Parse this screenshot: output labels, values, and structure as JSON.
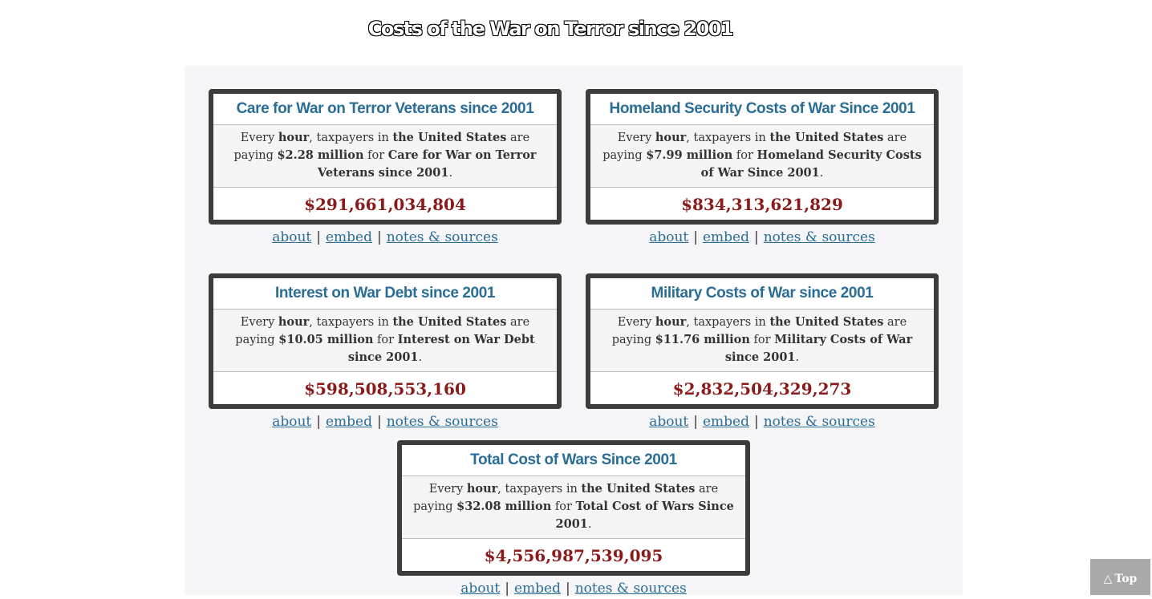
{
  "page": {
    "title": "Costs of the War on Terror since 2001"
  },
  "counters": [
    {
      "title": "Care for War on Terror Veterans since 2001",
      "desc_prefix": "Every ",
      "desc_hour": "hour",
      "desc_mid": ", taxpayers in ",
      "desc_country": "the United States",
      "desc_paying": " are paying ",
      "rate": "$2.28 million",
      "desc_for": " for ",
      "item": "Care for War on Terror Veterans since 2001",
      "desc_end": ".",
      "total": "$291,661,034,804"
    },
    {
      "title": "Homeland Security Costs of War Since 2001",
      "desc_prefix": "Every ",
      "desc_hour": "hour",
      "desc_mid": ", taxpayers in ",
      "desc_country": "the United States",
      "desc_paying": " are paying ",
      "rate": "$7.99 million",
      "desc_for": " for ",
      "item": "Homeland Security Costs of War Since 2001",
      "desc_end": ".",
      "total": "$834,313,621,829"
    },
    {
      "title": "Interest on War Debt since 2001",
      "desc_prefix": "Every ",
      "desc_hour": "hour",
      "desc_mid": ", taxpayers in ",
      "desc_country": "the United States",
      "desc_paying": " are paying ",
      "rate": "$10.05 million",
      "desc_for": " for ",
      "item": "Interest on War Debt since 2001",
      "desc_end": ".",
      "total": "$598,508,553,160"
    },
    {
      "title": "Military Costs of War since 2001",
      "desc_prefix": "Every ",
      "desc_hour": "hour",
      "desc_mid": ", taxpayers in ",
      "desc_country": "the United States",
      "desc_paying": " are paying ",
      "rate": "$11.76 million",
      "desc_for": " for ",
      "item": "Military Costs of War since 2001",
      "desc_end": ".",
      "total": "$2,832,504,329,273"
    },
    {
      "title": "Total Cost of Wars Since 2001",
      "desc_prefix": "Every ",
      "desc_hour": "hour",
      "desc_mid": ", taxpayers in ",
      "desc_country": "the United States",
      "desc_paying": " are paying ",
      "rate": "$32.08 million",
      "desc_for": " for ",
      "item": "Total Cost of Wars Since 2001",
      "desc_end": ".",
      "total": "$4,556,987,539,095"
    }
  ],
  "links": {
    "about": "about",
    "embed": "embed",
    "notes": "notes & sources",
    "separator": "|"
  },
  "top_button": {
    "icon": "triangle-up-icon",
    "glyph": "△",
    "label": "Top"
  },
  "colors": {
    "title_blue": "#2a6d97",
    "total_red": "#8b1a1a",
    "border": "#3c3c3c",
    "panel_bg": "#f6f6f8"
  }
}
